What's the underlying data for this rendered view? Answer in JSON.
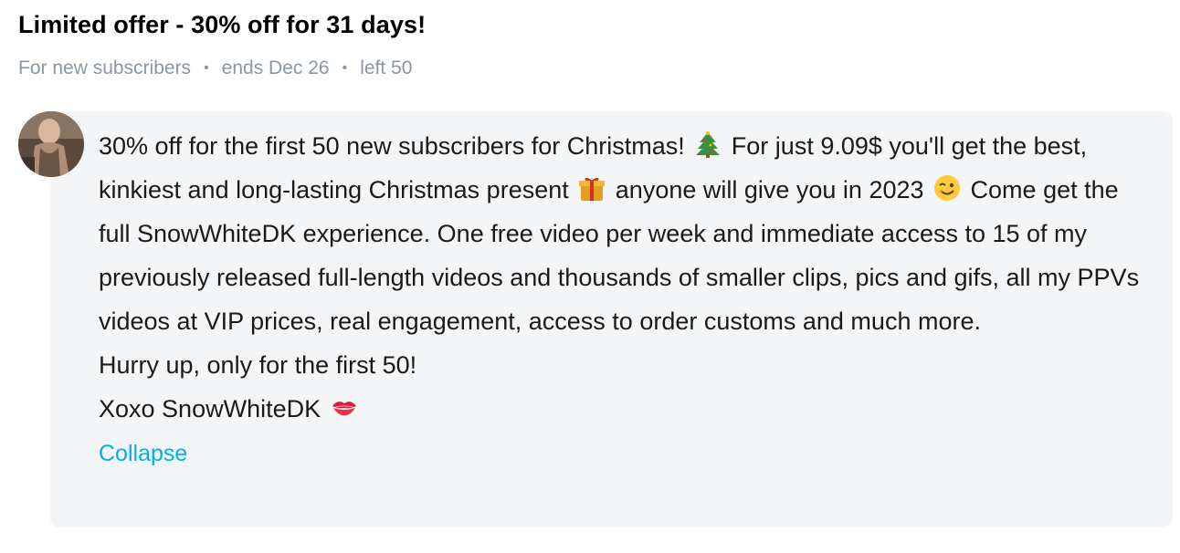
{
  "offer": {
    "title": "Limited offer - 30% off for 31 days!",
    "meta": {
      "audience": "For new subscribers",
      "ends": "ends Dec 26",
      "left": "left 50",
      "separator": "•"
    }
  },
  "message": {
    "seg1": "30% off for the first 50 new subscribers for Christmas!",
    "seg2": "For just 9.09$ you'll get the best, kinkiest and long-lasting Christmas present",
    "seg3": "anyone will give you in 2023",
    "seg4": "Come get the full SnowWhiteDK experience. One free video per week and immediate access to 15 of my previously released full-length videos and thousands of smaller clips, pics and gifs, all my PPVs videos at VIP prices, real engagement, access to order customs and much more.",
    "line2": "Hurry up, only for the first 50!",
    "line3": "Xoxo SnowWhiteDK",
    "emoji_names": [
      "christmas-tree-icon",
      "gift-icon",
      "winking-face-icon",
      "kiss-mark-icon"
    ]
  },
  "actions": {
    "collapse_label": "Collapse"
  },
  "colors": {
    "accent_link": "#00aff0",
    "meta_text": "#8a96a3",
    "card_bg": "#f4f5f7"
  }
}
